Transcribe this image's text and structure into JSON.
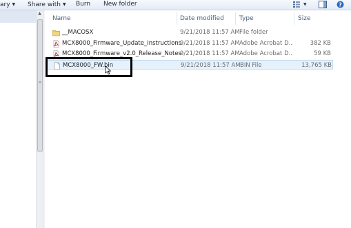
{
  "toolbar": {
    "organize_label": "ary",
    "share_label": "Share with",
    "burn_label": "Burn",
    "new_folder_label": "New folder"
  },
  "columns": {
    "name": "Name",
    "date": "Date modified",
    "type": "Type",
    "size": "Size"
  },
  "files": [
    {
      "name": "__MACOSX",
      "date": "9/21/2018 11:57 AM",
      "type": "File folder",
      "size": "",
      "icon": "folder-icon"
    },
    {
      "name": "MCX8000_Firmware_Update_Instructions",
      "date": "9/21/2018 11:57 AM",
      "type": "Adobe Acrobat D...",
      "size": "382 KB",
      "icon": "pdf-icon"
    },
    {
      "name": "MCX8000_Firmware_v2.0_Release_Notes",
      "date": "9/21/2018 11:57 AM",
      "type": "Adobe Acrobat D...",
      "size": "59 KB",
      "icon": "pdf-icon"
    },
    {
      "name": "MCX8000_FW.bin",
      "date": "9/21/2018 11:57 AM",
      "type": "BIN File",
      "size": "13,765 KB",
      "icon": "file-icon"
    }
  ],
  "colors": {
    "toolbar_bg": "#e3ebf5",
    "selection_bg": "#e5f1fb",
    "highlight_border": "#000000",
    "folder": "#e8c460",
    "pdf": "#c8201c"
  }
}
